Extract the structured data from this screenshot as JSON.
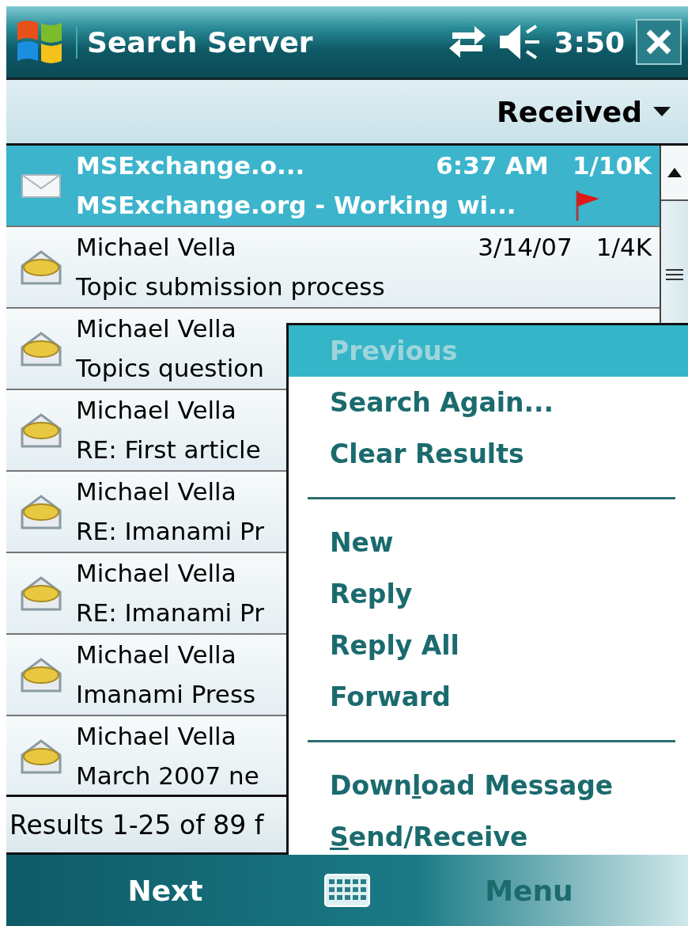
{
  "title_bar": {
    "title": "Search Server",
    "time": "3:50"
  },
  "sort": {
    "label": "Received"
  },
  "messages": [
    {
      "from": "MSExchange.o...",
      "date": "6:37 AM",
      "size": "1/10K",
      "subject": "MSExchange.org - Working wi...",
      "selected": true,
      "read": false,
      "flagged": true
    },
    {
      "from": "Michael Vella",
      "date": "3/14/07",
      "size": "1/4K",
      "subject": "Topic submission process",
      "selected": false,
      "read": true,
      "flagged": false
    },
    {
      "from": "Michael Vella",
      "subject": "Topics question",
      "selected": false,
      "read": true,
      "flagged": false
    },
    {
      "from": "Michael Vella",
      "subject": "RE: First article",
      "selected": false,
      "read": true,
      "flagged": false
    },
    {
      "from": "Michael Vella",
      "subject": "RE: Imanami Pr",
      "selected": false,
      "read": true,
      "flagged": false
    },
    {
      "from": "Michael Vella",
      "subject": "RE: Imanami Pr",
      "selected": false,
      "read": true,
      "flagged": false
    },
    {
      "from": "Michael Vella",
      "subject": "Imanami Press",
      "selected": false,
      "read": true,
      "flagged": false
    },
    {
      "from": "Michael Vella",
      "subject": "March 2007 ne",
      "selected": false,
      "read": true,
      "flagged": false
    }
  ],
  "footer": "Results 1-25 of 89 f",
  "menu": [
    {
      "kind": "item",
      "label": [
        {
          "text": "Previous",
          "underlined": false
        }
      ],
      "selected": true,
      "disabled": true
    },
    {
      "kind": "item",
      "label": [
        {
          "text": "Search Again...",
          "underlined": false
        }
      ],
      "selected": false,
      "disabled": false
    },
    {
      "kind": "item",
      "label": [
        {
          "text": "Clear Results",
          "underlined": false
        }
      ],
      "selected": false,
      "disabled": false
    },
    {
      "kind": "separator"
    },
    {
      "kind": "item",
      "label": [
        {
          "text": "New",
          "underlined": false
        }
      ],
      "selected": false,
      "disabled": false
    },
    {
      "kind": "item",
      "label": [
        {
          "text": "Reply",
          "underlined": false
        }
      ],
      "selected": false,
      "disabled": false
    },
    {
      "kind": "item",
      "label": [
        {
          "text": "Reply All",
          "underlined": false
        }
      ],
      "selected": false,
      "disabled": false
    },
    {
      "kind": "item",
      "label": [
        {
          "text": "Forward",
          "underlined": false
        }
      ],
      "selected": false,
      "disabled": false
    },
    {
      "kind": "separator"
    },
    {
      "kind": "item",
      "label": [
        {
          "text": "Down",
          "underlined": false
        },
        {
          "text": "l",
          "underlined": true
        },
        {
          "text": "oad Message",
          "underlined": false
        }
      ],
      "selected": false,
      "disabled": false
    },
    {
      "kind": "item",
      "label": [
        {
          "text": "S",
          "underlined": true
        },
        {
          "text": "end/Receive",
          "underlined": false
        }
      ],
      "selected": false,
      "disabled": false
    }
  ],
  "softkeys": {
    "left": "Next",
    "right": "Menu"
  }
}
